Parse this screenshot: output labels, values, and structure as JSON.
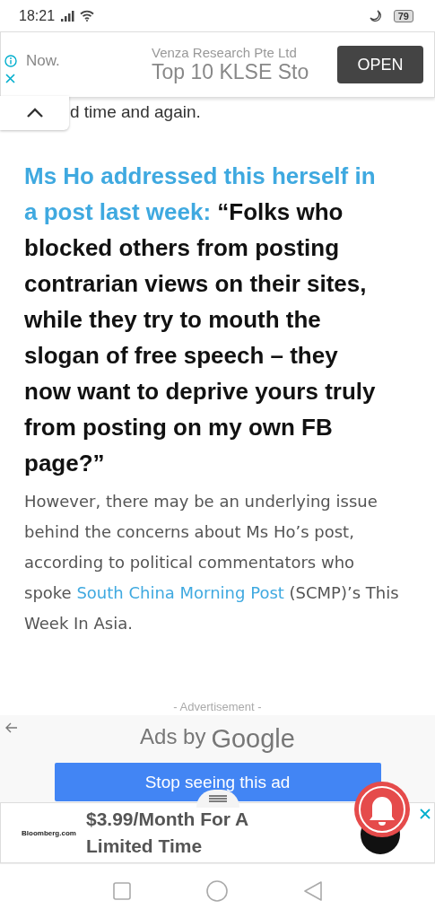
{
  "status_bar": {
    "time": "18:21",
    "battery": "79"
  },
  "top_ad": {
    "left_text": "Now.",
    "advertiser": "Venza Research Pte Ltd",
    "headline": "Top 10 KLSE Sto",
    "button": "OPEN"
  },
  "article": {
    "cut_line": "d time and again.",
    "quote": {
      "link": "Ms Ho addressed this herself in a post last week:",
      "text": " “Folks who blocked others from posting contrarian views on their sites, while they try to mouth the slogan of free speech – they now want to deprive yours truly from posting on my own FB page?”"
    },
    "paragraph": {
      "before": "However, there may be an underlying issue behind the concerns about Ms Ho’s post, according to political commentators who spoke ",
      "link": "South China Morning Post",
      "after": " (SCMP)’s This Week In Asia."
    }
  },
  "ad_label": "- Advertisement -",
  "ad_panel": {
    "ads_by": "Ads by",
    "brand": "Google",
    "button": "Stop seeing this ad"
  },
  "bottom_ad": {
    "logo": "Bloomberg.com",
    "headline": "$3.99/Month For A Limited Time"
  }
}
